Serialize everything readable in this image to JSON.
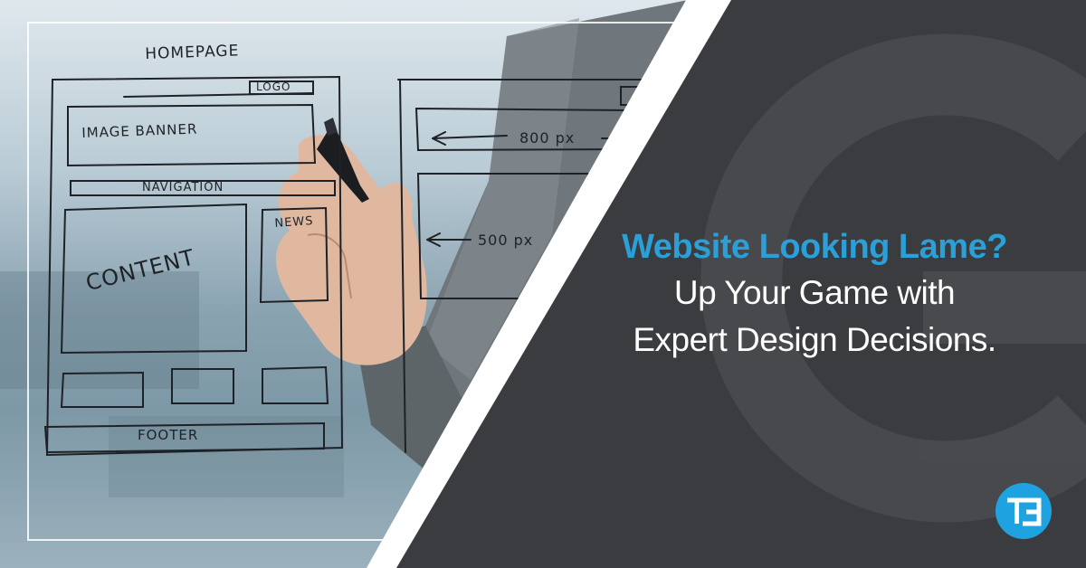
{
  "headline": {
    "line1": "Website Looking Lame?",
    "line2": "Up Your Game with",
    "line3": "Expert Design Decisions."
  },
  "sketch": {
    "homepage": "HOMEPAGE",
    "logo": "LOGO",
    "image_banner": "IMAGE BANNER",
    "navigation": "NAVIGATION",
    "content": "CONTENT",
    "news": "NEWS",
    "footer": "FOOTER",
    "width_800": "800 px",
    "width_500": "500 px"
  },
  "brand": {
    "logo_letters": "TE",
    "accent_color": "#2a9fd8",
    "panel_color": "#3a3c3f"
  }
}
